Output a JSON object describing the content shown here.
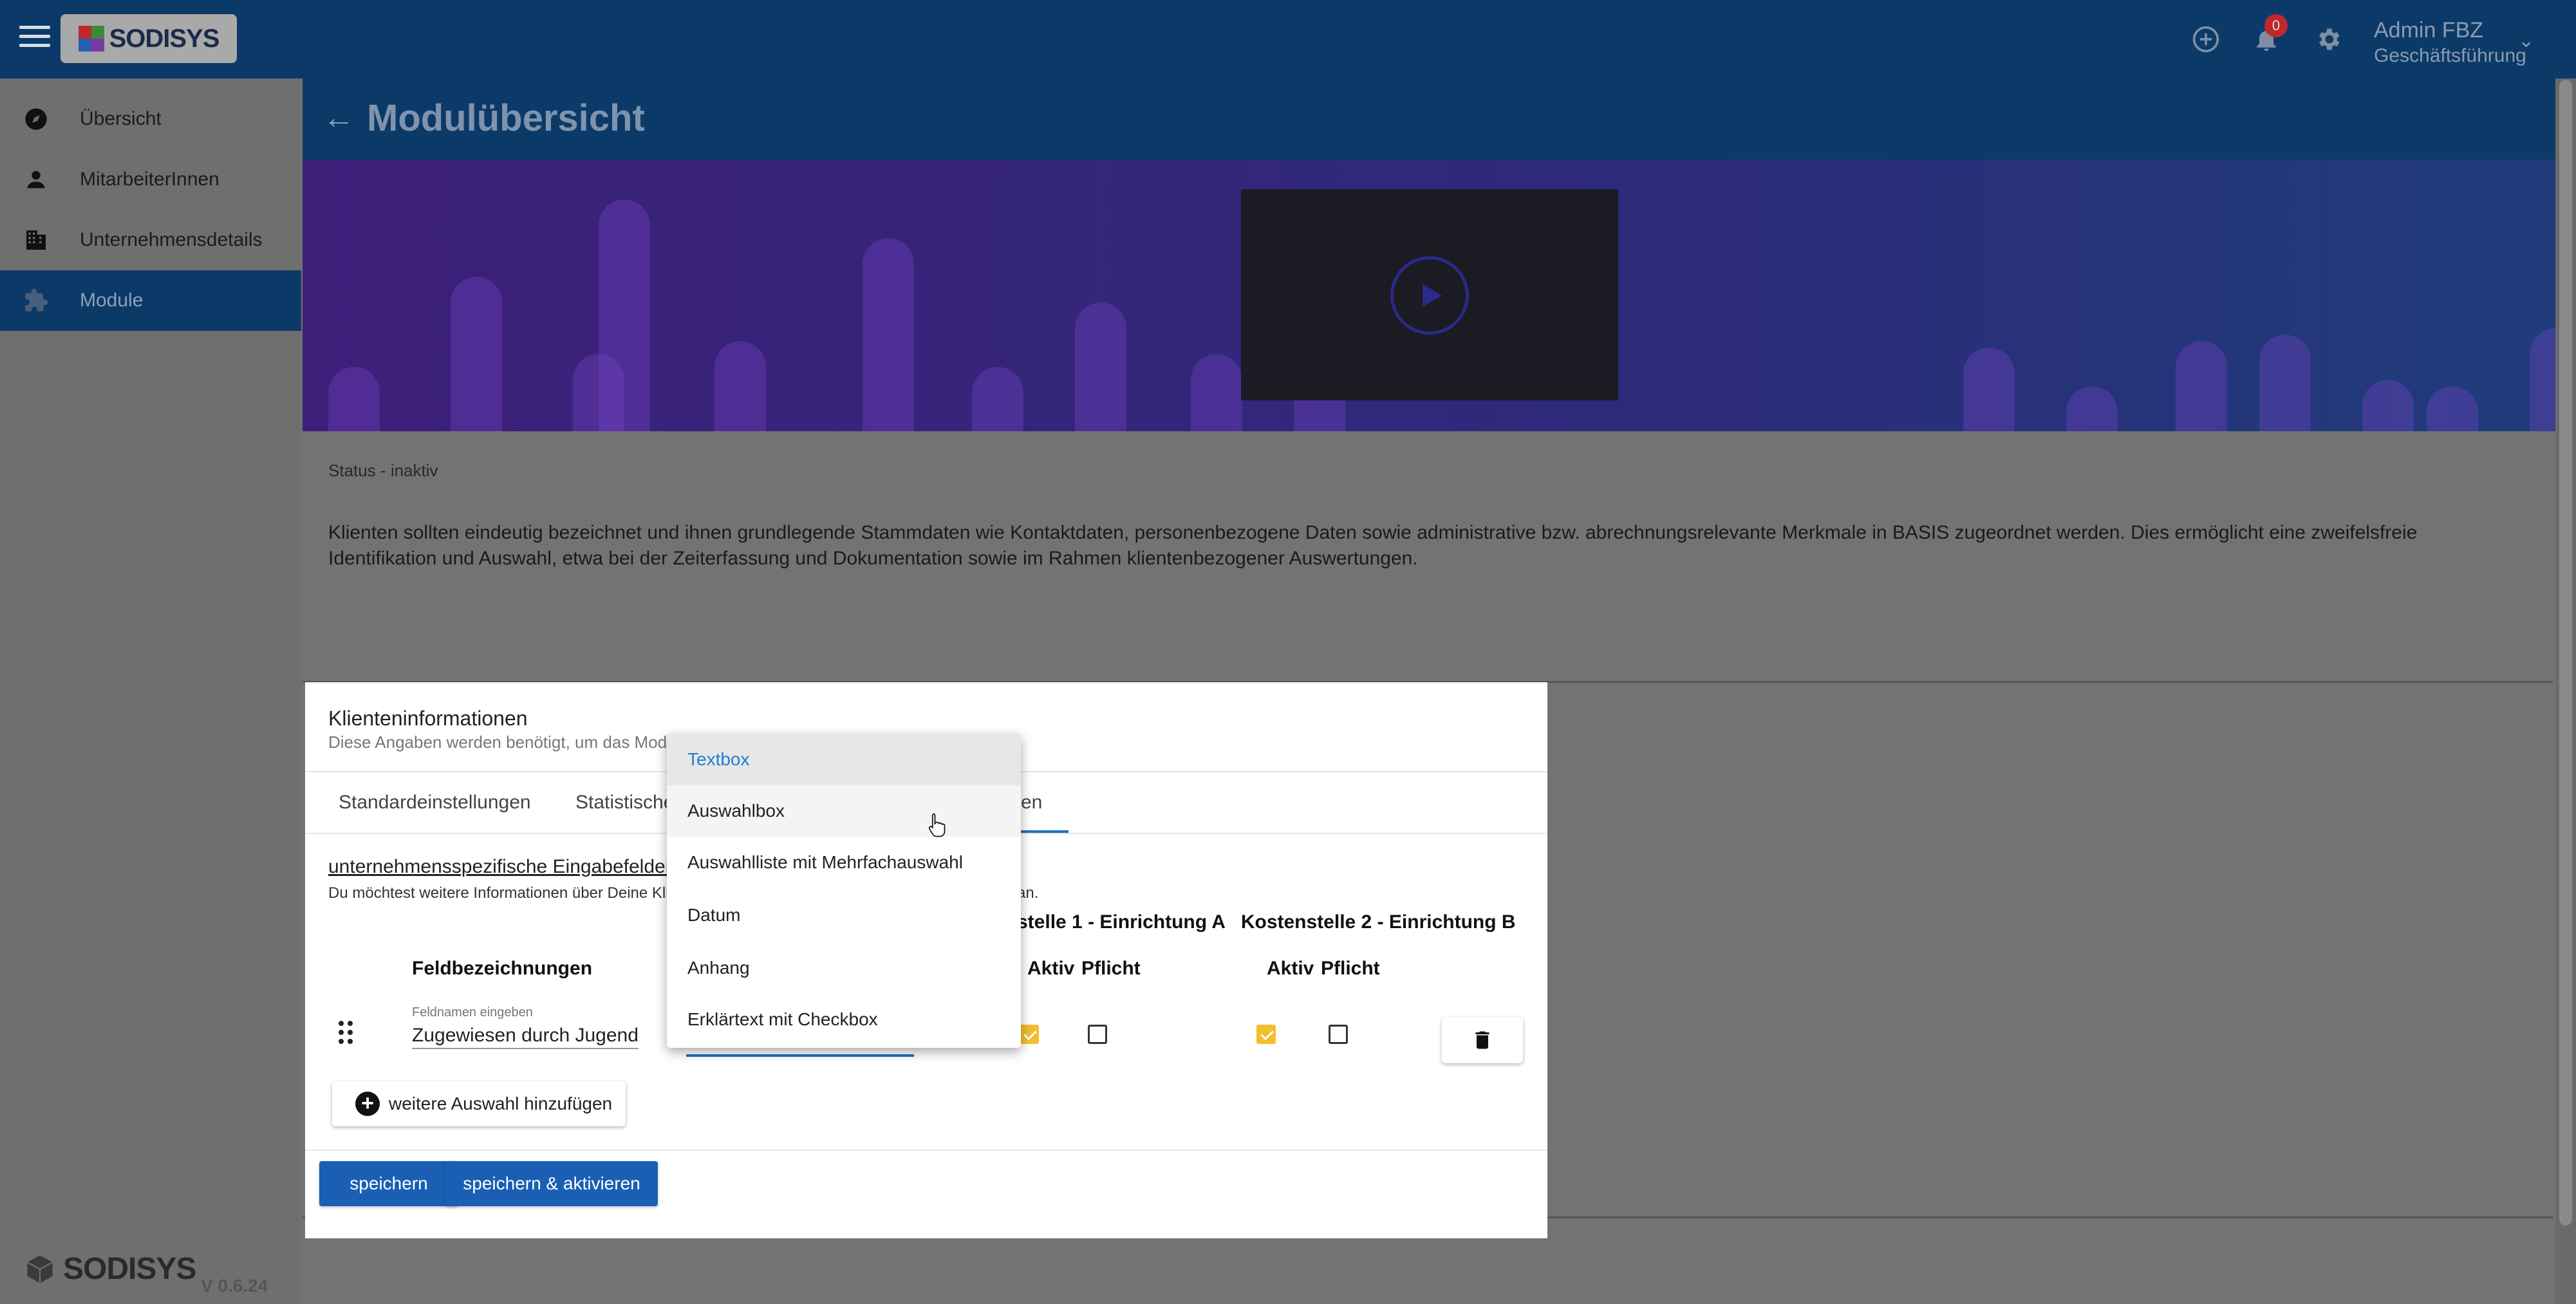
{
  "app": {
    "logo_text": "SODISYS",
    "version": "V 0.6.24"
  },
  "topbar": {
    "notification_count": "0",
    "user_name": "Admin FBZ",
    "user_role": "Geschäftsführung"
  },
  "sidebar": {
    "items": [
      {
        "label": "Übersicht",
        "icon": "compass-icon",
        "active": false
      },
      {
        "label": "MitarbeiterInnen",
        "icon": "person-icon",
        "active": false
      },
      {
        "label": "Unternehmensdetails",
        "icon": "building-icon",
        "active": false
      },
      {
        "label": "Module",
        "icon": "puzzle-icon",
        "active": true
      }
    ]
  },
  "header": {
    "title": "Modulübersicht"
  },
  "module": {
    "status": "Status - inaktiv",
    "description": "Klienten sollten eindeutig bezeichnet und ihnen grundlegende Stammdaten wie Kontaktdaten, personenbezogene Daten sowie administrative bzw. abrechnungsrelevante Merkmale in BASIS zugeordnet werden. Dies ermöglicht eine zweifelsfreie Identifikation und Auswahl, etwa bei der Zeiterfassung und Dokumentation sowie im Rahmen klientenbezogener Auswertungen."
  },
  "dialog": {
    "title": "Klienteninformationen",
    "subtitle": "Diese Angaben werden benötigt, um das Modu",
    "tabs": [
      {
        "label": "Standardeinstellungen"
      },
      {
        "label": "Statistische"
      },
      {
        "label": "en"
      }
    ],
    "section_title": "unternehmensspezifische Eingabefelder",
    "section_note": "Du möchtest weitere Informationen über Deine Klien",
    "section_note_tail": "an.",
    "cost_centers": "stelle 1 - Einrichtung A   Kostenstelle 2 - Einrichtung B",
    "columns": {
      "field_names": "Feldbezeichnungen",
      "active_1": "Aktiv",
      "required_1": "Pflicht",
      "active_2": "Aktiv",
      "required_2": "Pflicht"
    },
    "row": {
      "field_hint": "Feldnamen eingeben",
      "field_value": "Zugewiesen durch Jugendamt",
      "active_1": true,
      "required_1": false,
      "active_2": true,
      "required_2": false
    },
    "add_button": "weitere Auswahl hinzufügen",
    "save_button": "speichern",
    "save_activate_button": "speichern & aktivieren"
  },
  "dropdown": {
    "options": [
      {
        "label": "Textbox",
        "state": "selected"
      },
      {
        "label": "Auswahlbox",
        "state": "hover"
      },
      {
        "label": "Auswahlliste mit Mehrfachauswahl",
        "state": ""
      },
      {
        "label": "Datum",
        "state": ""
      },
      {
        "label": "Anhang",
        "state": ""
      },
      {
        "label": "Erklärtext mit Checkbox",
        "state": ""
      }
    ]
  },
  "colors": {
    "brand": "#0c3a68",
    "accent": "#1a5fb4",
    "checkbox": "#f2c02e",
    "badge": "#c0282e"
  }
}
